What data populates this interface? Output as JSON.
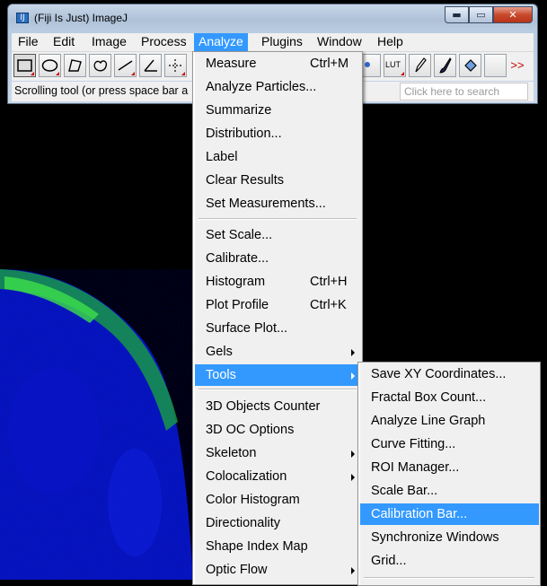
{
  "window": {
    "title": "(Fiji Is Just) ImageJ",
    "minimize_label": "▬",
    "maximize_label": "▭",
    "close_label": "✕"
  },
  "menubar": {
    "items": [
      "File",
      "Edit",
      "Image",
      "Process",
      "Analyze",
      "Plugins",
      "Window",
      "Help"
    ],
    "active": "Analyze"
  },
  "toolbar": {
    "lut_label": "LUT",
    "more_label": ">>"
  },
  "status": {
    "text": "Scrolling tool (or press space bar a",
    "search_placeholder": "Click here to search"
  },
  "analyze_menu": {
    "items": [
      {
        "label": "Measure",
        "shortcut": "Ctrl+M"
      },
      {
        "label": "Analyze Particles..."
      },
      {
        "label": "Summarize"
      },
      {
        "label": "Distribution..."
      },
      {
        "label": "Label"
      },
      {
        "label": "Clear Results"
      },
      {
        "label": "Set Measurements..."
      },
      {
        "label": "Set Scale..."
      },
      {
        "label": "Calibrate..."
      },
      {
        "label": "Histogram",
        "shortcut": "Ctrl+H"
      },
      {
        "label": "Plot Profile",
        "shortcut": "Ctrl+K"
      },
      {
        "label": "Surface Plot..."
      },
      {
        "label": "Gels",
        "submenu": true
      },
      {
        "label": "Tools",
        "submenu": true,
        "highlighted": true
      },
      {
        "label": "3D Objects Counter"
      },
      {
        "label": "3D OC Options"
      },
      {
        "label": "Skeleton",
        "submenu": true
      },
      {
        "label": "Colocalization",
        "submenu": true
      },
      {
        "label": "Color Histogram"
      },
      {
        "label": "Directionality"
      },
      {
        "label": "Shape Index Map"
      },
      {
        "label": "Optic Flow",
        "submenu": true
      }
    ]
  },
  "tools_submenu": {
    "items": [
      {
        "label": "Save XY Coordinates..."
      },
      {
        "label": "Fractal Box Count..."
      },
      {
        "label": "Analyze Line Graph"
      },
      {
        "label": "Curve Fitting..."
      },
      {
        "label": "ROI Manager..."
      },
      {
        "label": "Scale Bar..."
      },
      {
        "label": "Calibration Bar...",
        "highlighted": true
      },
      {
        "label": "Synchronize Windows"
      },
      {
        "label": "Grid..."
      }
    ]
  },
  "colors": {
    "highlight": "#3399ff",
    "menu_bg": "#f0f0f0",
    "image_blue": "#0a1fd0",
    "image_green": "#22c832"
  }
}
